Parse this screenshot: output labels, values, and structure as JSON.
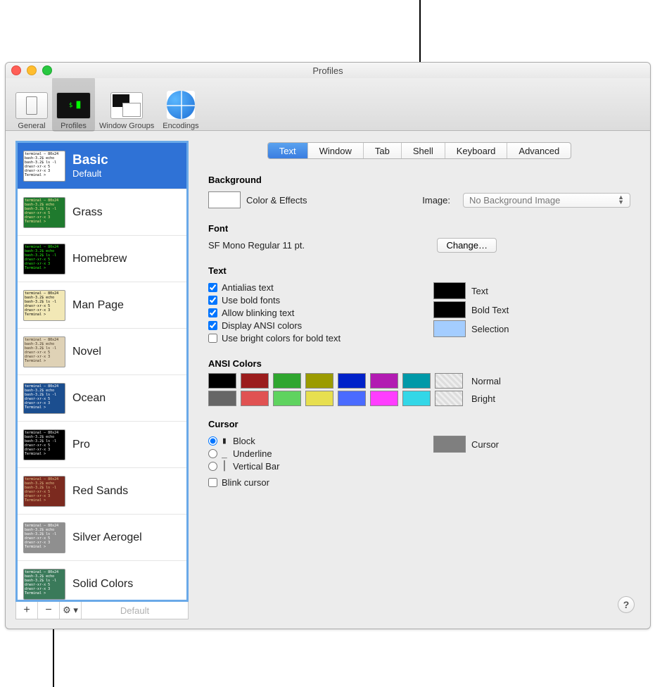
{
  "window": {
    "title": "Profiles"
  },
  "toolbar": {
    "items": [
      {
        "label": "General"
      },
      {
        "label": "Profiles"
      },
      {
        "label": "Window Groups"
      },
      {
        "label": "Encodings"
      }
    ]
  },
  "sidebar": {
    "items": [
      {
        "name": "Basic",
        "subtitle": "Default",
        "thumb_bg": "#ffffff",
        "thumb_fg": "#000000"
      },
      {
        "name": "Grass",
        "thumb_bg": "#1f7a2e",
        "thumb_fg": "#f5e39a"
      },
      {
        "name": "Homebrew",
        "thumb_bg": "#000000",
        "thumb_fg": "#28fe14"
      },
      {
        "name": "Man Page",
        "thumb_bg": "#f2e8b6",
        "thumb_fg": "#000000"
      },
      {
        "name": "Novel",
        "thumb_bg": "#dfd2b6",
        "thumb_fg": "#3b2b1a"
      },
      {
        "name": "Ocean",
        "thumb_bg": "#1b4e8f",
        "thumb_fg": "#ffffff"
      },
      {
        "name": "Pro",
        "thumb_bg": "#000000",
        "thumb_fg": "#f2f2f2"
      },
      {
        "name": "Red Sands",
        "thumb_bg": "#7b2a1f",
        "thumb_fg": "#e0c28a"
      },
      {
        "name": "Silver Aerogel",
        "thumb_bg": "#8f8f8f",
        "thumb_fg": "#ffffff"
      },
      {
        "name": "Solid Colors",
        "thumb_bg": "#3a7a5a",
        "thumb_fg": "#ffffff"
      }
    ],
    "footer": {
      "add": "+",
      "remove": "−",
      "gear": "⚙︎",
      "gear_arrow": "▾",
      "default_label": "Default"
    }
  },
  "tabs": [
    "Text",
    "Window",
    "Tab",
    "Shell",
    "Keyboard",
    "Advanced"
  ],
  "sections": {
    "background": {
      "heading": "Background",
      "color_effects_label": "Color & Effects",
      "image_label": "Image:",
      "image_value": "No Background Image"
    },
    "font": {
      "heading": "Font",
      "value": "SF Mono Regular 11 pt.",
      "change_label": "Change…"
    },
    "text": {
      "heading": "Text",
      "antialias": "Antialias text",
      "bold_fonts": "Use bold fonts",
      "blinking": "Allow blinking text",
      "ansi": "Display ANSI colors",
      "bright_bold": "Use bright colors for bold text",
      "text_color_label": "Text",
      "bold_color_label": "Bold Text",
      "sel_color_label": "Selection"
    },
    "ansi": {
      "heading": "ANSI Colors",
      "normal_label": "Normal",
      "bright_label": "Bright",
      "normal": [
        "#000000",
        "#9b1c1c",
        "#2fa62f",
        "#9b9b00",
        "#0021c9",
        "#b21bb2",
        "#0099a8",
        "#cccccc"
      ],
      "bright": [
        "#666666",
        "#e05252",
        "#5fd35f",
        "#e7df4f",
        "#4a6bff",
        "#ff3dff",
        "#33d7e7",
        "#f2f2f2"
      ]
    },
    "cursor": {
      "heading": "Cursor",
      "block": "Block",
      "underline": "Underline",
      "vbar": "Vertical Bar",
      "blink": "Blink cursor",
      "color_label": "Cursor"
    }
  },
  "colors": {
    "bg_well": "#ffffff",
    "text_well": "#000000",
    "bold_well": "#000000",
    "sel_well": "#a4cdff",
    "cursor_well": "#7f7f7f"
  },
  "help": "?"
}
